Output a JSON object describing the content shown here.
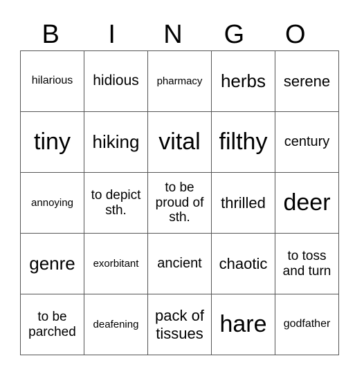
{
  "header": [
    "B",
    "I",
    "N",
    "G",
    "O"
  ],
  "rows": [
    [
      "hilarious",
      "hidious",
      "pharmacy",
      "herbs",
      "serene"
    ],
    [
      "tiny",
      "hiking",
      "vital",
      "filthy",
      "century"
    ],
    [
      "annoying",
      "to depict sth.",
      "to be proud of sth.",
      "thrilled",
      "deer"
    ],
    [
      "genre",
      "exorbitant",
      "ancient",
      "chaotic",
      "to toss and turn"
    ],
    [
      "to be parched",
      "deafening",
      "pack of tissues",
      "hare",
      "godfather"
    ]
  ]
}
